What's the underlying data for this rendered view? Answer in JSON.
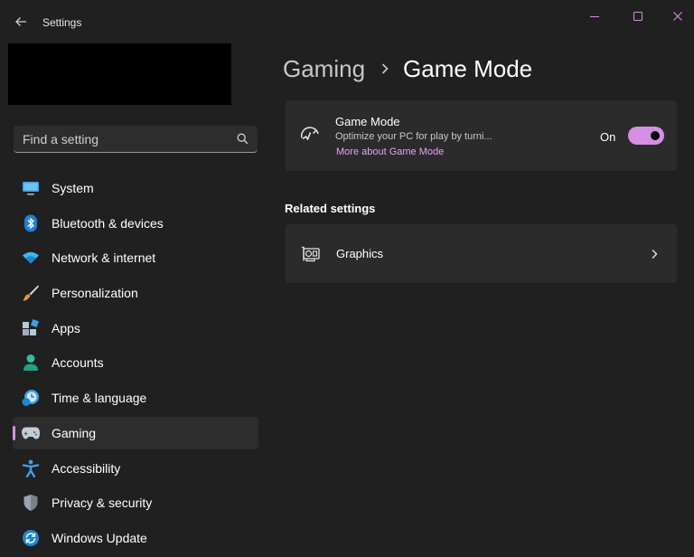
{
  "window": {
    "title": "Settings",
    "controls": {
      "minimize": "minimize-icon",
      "maximize": "maximize-icon",
      "close": "close-icon"
    }
  },
  "search": {
    "placeholder": "Find a setting"
  },
  "sidebar": {
    "items": [
      {
        "label": "System",
        "icon": "system-monitor-icon"
      },
      {
        "label": "Bluetooth & devices",
        "icon": "bluetooth-icon"
      },
      {
        "label": "Network & internet",
        "icon": "wifi-icon"
      },
      {
        "label": "Personalization",
        "icon": "paintbrush-icon"
      },
      {
        "label": "Apps",
        "icon": "apps-icon"
      },
      {
        "label": "Accounts",
        "icon": "person-icon"
      },
      {
        "label": "Time & language",
        "icon": "clock-globe-icon"
      },
      {
        "label": "Gaming",
        "icon": "gamepad-icon",
        "selected": true
      },
      {
        "label": "Accessibility",
        "icon": "accessibility-icon"
      },
      {
        "label": "Privacy & security",
        "icon": "shield-icon"
      },
      {
        "label": "Windows Update",
        "icon": "sync-icon"
      }
    ]
  },
  "breadcrumb": {
    "parent": "Gaming",
    "current": "Game Mode"
  },
  "game_mode_card": {
    "title": "Game Mode",
    "description": "Optimize your PC for play by turni...",
    "link": "More about Game Mode",
    "state_label": "On",
    "toggle_on": true
  },
  "related": {
    "heading": "Related settings",
    "items": [
      {
        "label": "Graphics",
        "icon": "graphics-card-icon"
      }
    ]
  },
  "colors": {
    "background": "#202020",
    "card": "#2b2b2b",
    "accent": "#d68fe3",
    "link": "#e2a6f0"
  }
}
